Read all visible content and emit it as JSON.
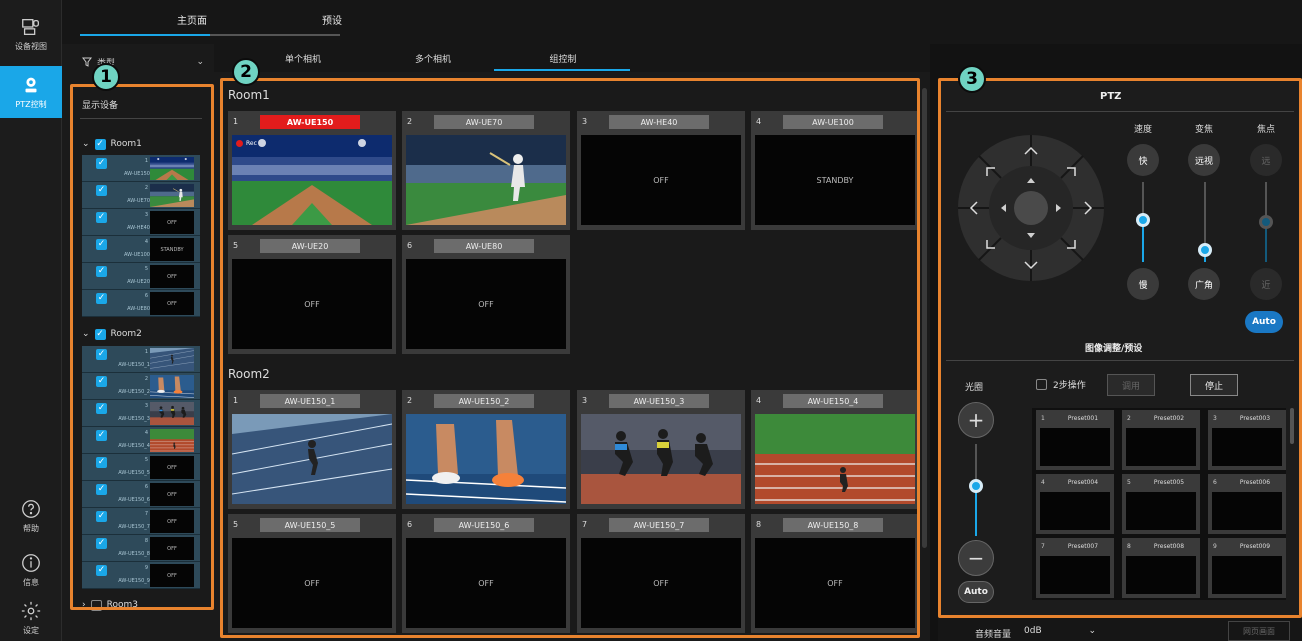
{
  "nav": {
    "items": [
      {
        "label": "设备视图",
        "icon": "device-view-icon"
      },
      {
        "label": "PTZ控制",
        "icon": "ptz-control-icon"
      },
      {
        "label": "帮助",
        "icon": "help-icon"
      },
      {
        "label": "信息",
        "icon": "info-icon"
      },
      {
        "label": "设定",
        "icon": "settings-gear-icon"
      }
    ]
  },
  "top_tabs": [
    "主页面",
    "预设"
  ],
  "panel1": {
    "badge": "1",
    "filter_label": "类型",
    "show_devices": "显示设备",
    "rooms": [
      {
        "name": "Room1",
        "devices": [
          {
            "num": "1",
            "name": "AW-UE150",
            "status": ""
          },
          {
            "num": "2",
            "name": "AW-UE70",
            "status": ""
          },
          {
            "num": "3",
            "name": "AW-HE40",
            "status": "OFF"
          },
          {
            "num": "4",
            "name": "AW-UE100",
            "status": "STANDBY"
          },
          {
            "num": "5",
            "name": "AW-UE20",
            "status": "OFF"
          },
          {
            "num": "6",
            "name": "AW-UE80",
            "status": "OFF"
          }
        ]
      },
      {
        "name": "Room2",
        "devices": [
          {
            "num": "1",
            "name": "AW-UE150_1",
            "status": ""
          },
          {
            "num": "2",
            "name": "AW-UE150_2",
            "status": ""
          },
          {
            "num": "3",
            "name": "AW-UE150_3",
            "status": ""
          },
          {
            "num": "4",
            "name": "AW-UE150_4",
            "status": ""
          },
          {
            "num": "5",
            "name": "AW-UE150_5",
            "status": "OFF"
          },
          {
            "num": "6",
            "name": "AW-UE150_6",
            "status": "OFF"
          },
          {
            "num": "7",
            "name": "AW-UE150_7",
            "status": "OFF"
          },
          {
            "num": "8",
            "name": "AW-UE150_8",
            "status": "OFF"
          },
          {
            "num": "9",
            "name": "AW-UE150_9",
            "status": "OFF"
          }
        ]
      },
      {
        "name": "Room3"
      }
    ]
  },
  "mid_tabs": [
    "单个相机",
    "多个相机",
    "组控制"
  ],
  "panel2": {
    "badge": "2",
    "rec_label": "Rec",
    "rooms": [
      {
        "title": "Room1",
        "tiles": [
          {
            "num": "1",
            "name": "AW-UE150",
            "status": "",
            "rec": true
          },
          {
            "num": "2",
            "name": "AW-UE70",
            "status": ""
          },
          {
            "num": "3",
            "name": "AW-HE40",
            "status": "OFF"
          },
          {
            "num": "4",
            "name": "AW-UE100",
            "status": "STANDBY"
          },
          {
            "num": "5",
            "name": "AW-UE20",
            "status": "OFF"
          },
          {
            "num": "6",
            "name": "AW-UE80",
            "status": "OFF"
          }
        ]
      },
      {
        "title": "Room2",
        "tiles": [
          {
            "num": "1",
            "name": "AW-UE150_1",
            "status": ""
          },
          {
            "num": "2",
            "name": "AW-UE150_2",
            "status": ""
          },
          {
            "num": "3",
            "name": "AW-UE150_3",
            "status": ""
          },
          {
            "num": "4",
            "name": "AW-UE150_4",
            "status": ""
          },
          {
            "num": "5",
            "name": "AW-UE150_5",
            "status": "OFF"
          },
          {
            "num": "6",
            "name": "AW-UE150_6",
            "status": "OFF"
          },
          {
            "num": "7",
            "name": "AW-UE150_7",
            "status": "OFF"
          },
          {
            "num": "8",
            "name": "AW-UE150_8",
            "status": "OFF"
          }
        ]
      }
    ]
  },
  "panel3": {
    "badge": "3",
    "ptz_title": "PTZ",
    "speed": {
      "label": "速度",
      "top": "快",
      "bottom": "慢"
    },
    "zoom": {
      "label": "变焦",
      "top": "远视",
      "bottom": "广角"
    },
    "focus": {
      "label": "焦点",
      "top": "远",
      "bottom": "近",
      "auto": "Auto"
    },
    "image_title": "图像调整/预设",
    "iris_label": "光圈",
    "iris_auto": "Auto",
    "two_step": "2步操作",
    "recall_btn": "调用",
    "stop_btn": "停止",
    "presets": [
      {
        "num": "1",
        "name": "Preset001"
      },
      {
        "num": "2",
        "name": "Preset002"
      },
      {
        "num": "3",
        "name": "Preset003"
      },
      {
        "num": "4",
        "name": "Preset004"
      },
      {
        "num": "5",
        "name": "Preset005"
      },
      {
        "num": "6",
        "name": "Preset006"
      },
      {
        "num": "7",
        "name": "Preset007"
      },
      {
        "num": "8",
        "name": "Preset008"
      },
      {
        "num": "9",
        "name": "Preset009"
      }
    ]
  },
  "bottom": {
    "audio_label": "音频音量",
    "audio_value": "0dB",
    "web_btn": "网页画面"
  },
  "colors": {
    "accent": "#1aa7e8",
    "rec": "#e21c1c",
    "highlight": "#e8832e",
    "badge": "#6fd3c2"
  }
}
